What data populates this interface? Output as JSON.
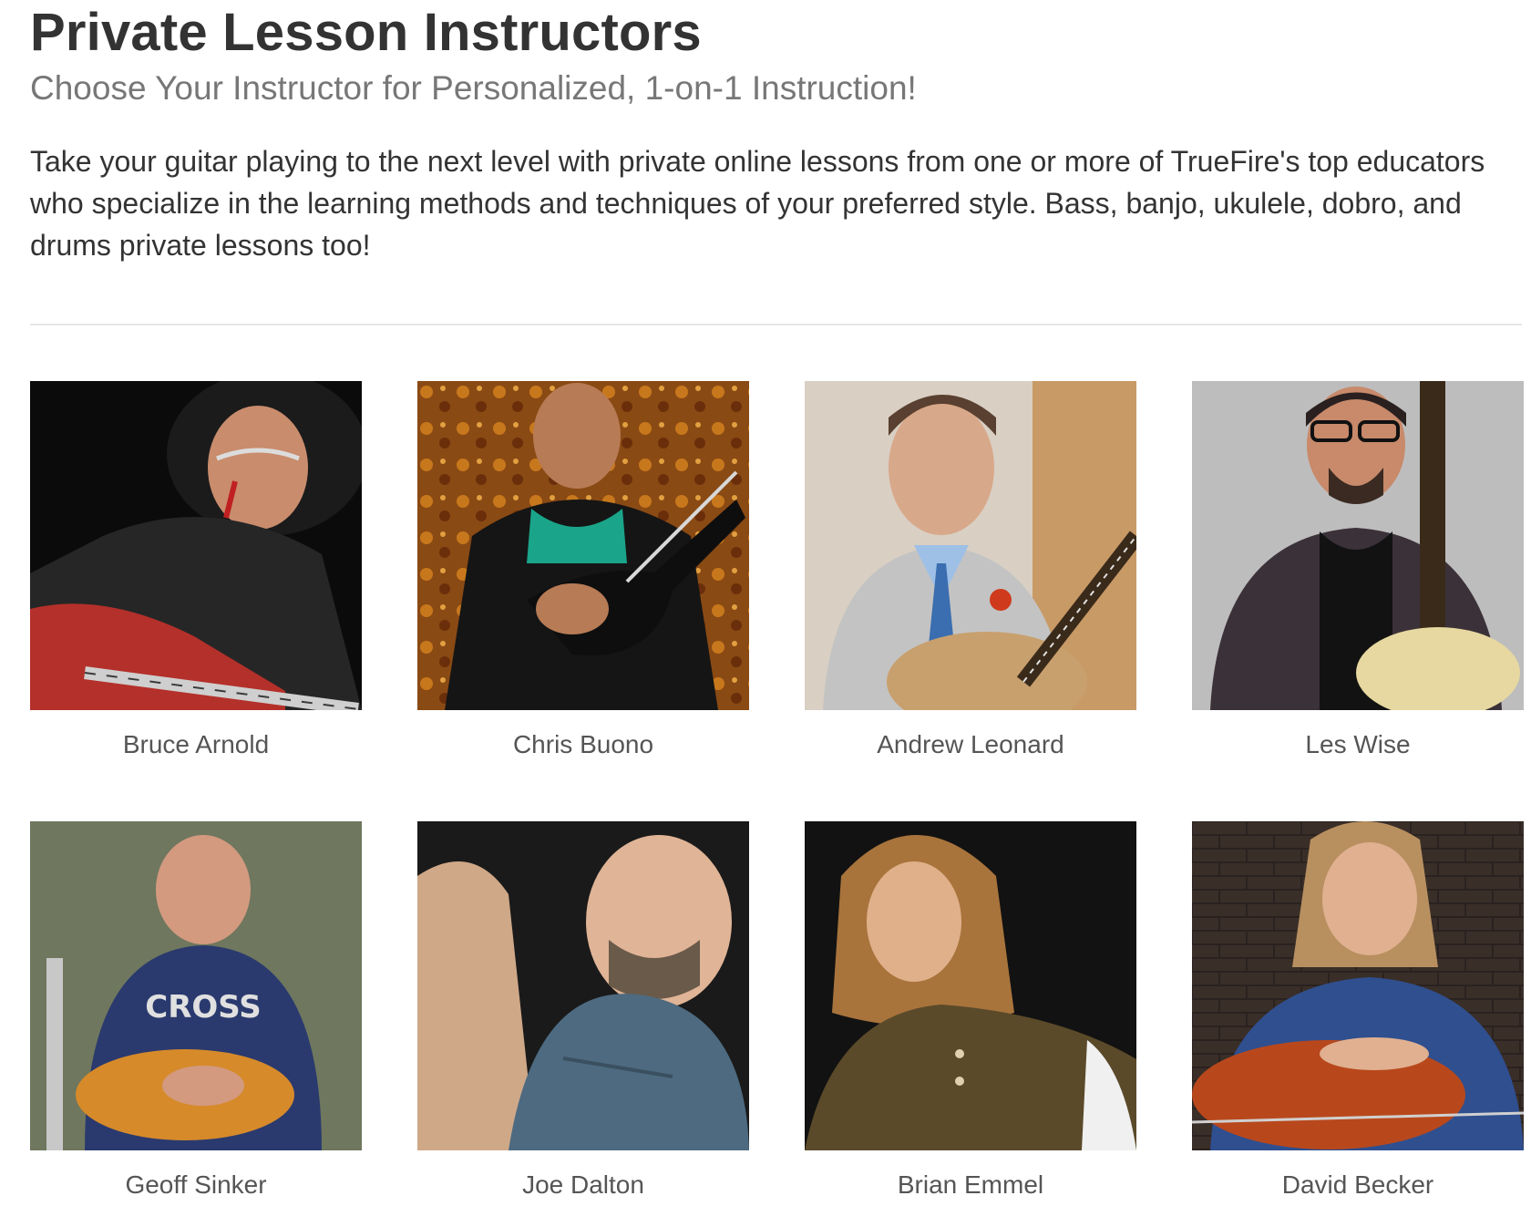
{
  "header": {
    "title": "Private Lesson Instructors",
    "subtitle": "Choose Your Instructor for Personalized, 1-on-1 Instruction!"
  },
  "intro": {
    "text": "Take your guitar playing to the next level with private online lessons from one or more of TrueFire's top educators who specialize in the learning methods and techniques of your preferred style. Bass, banjo, ukulele, dobro, and drums private lessons too!"
  },
  "instructors": [
    {
      "name": "Bruce Arnold",
      "photo_bg": "#0b0b0b",
      "accent": "#b4302a"
    },
    {
      "name": "Chris Buono",
      "photo_bg": "#8a4a14",
      "accent": "#1aa58a"
    },
    {
      "name": "Andrew Leonard",
      "photo_bg": "#d9cfc3",
      "accent": "#c8a06e"
    },
    {
      "name": "Les Wise",
      "photo_bg": "#bdbdbd",
      "accent": "#3b3138"
    },
    {
      "name": "Geoff Sinker",
      "photo_bg": "#6f775e",
      "accent": "#2a3a6e"
    },
    {
      "name": "Joe Dalton",
      "photo_bg": "#1a1a1a",
      "accent": "#4d6a80"
    },
    {
      "name": "Brian Emmel",
      "photo_bg": "#121212",
      "accent": "#5a4a2a"
    },
    {
      "name": "David Becker",
      "photo_bg": "#2a2220",
      "accent": "#2f4f8f"
    }
  ]
}
